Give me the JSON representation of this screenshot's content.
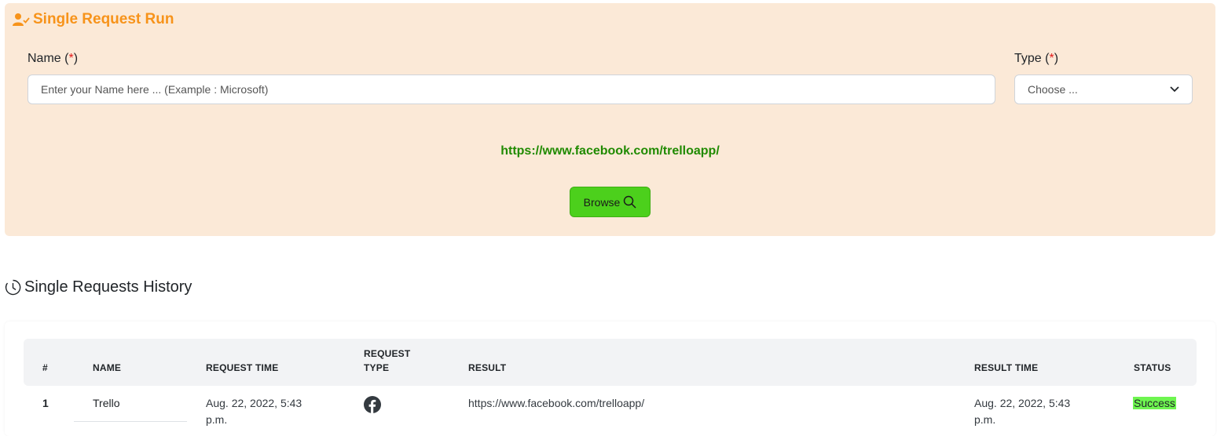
{
  "run_section": {
    "title": "Single Request Run",
    "name_label": "Name (",
    "name_required": "*",
    "name_label_end": ")",
    "name_placeholder": "Enter your Name here ... (Example : Microsoft)",
    "type_label": "Type (",
    "type_required": "*",
    "type_label_end": ")",
    "type_selected": "Choose ...",
    "url": "https://www.facebook.com/trelloapp/",
    "browse_label": "Browse",
    "accent_color": "#f7931a",
    "url_color": "#1f8a00",
    "button_color": "#4cd01c"
  },
  "history_section": {
    "title": "Single Requests History",
    "columns": {
      "index": "#",
      "name": "NAME",
      "request_time": "REQUEST TIME",
      "request_type_1": "REQUEST",
      "request_type_2": "TYPE",
      "result": "RESULT",
      "result_time": "RESULT TIME",
      "status": "STATUS"
    },
    "rows": [
      {
        "index": "1",
        "name": "Trello",
        "request_time_1": "Aug. 22, 2022, 5:43",
        "request_time_2": "p.m.",
        "request_type_icon": "facebook-icon",
        "result": "https://www.facebook.com/trelloapp/",
        "result_time_1": "Aug. 22, 2022, 5:43",
        "result_time_2": "p.m.",
        "status": "Success"
      }
    ],
    "status_color": "#6ef550"
  }
}
